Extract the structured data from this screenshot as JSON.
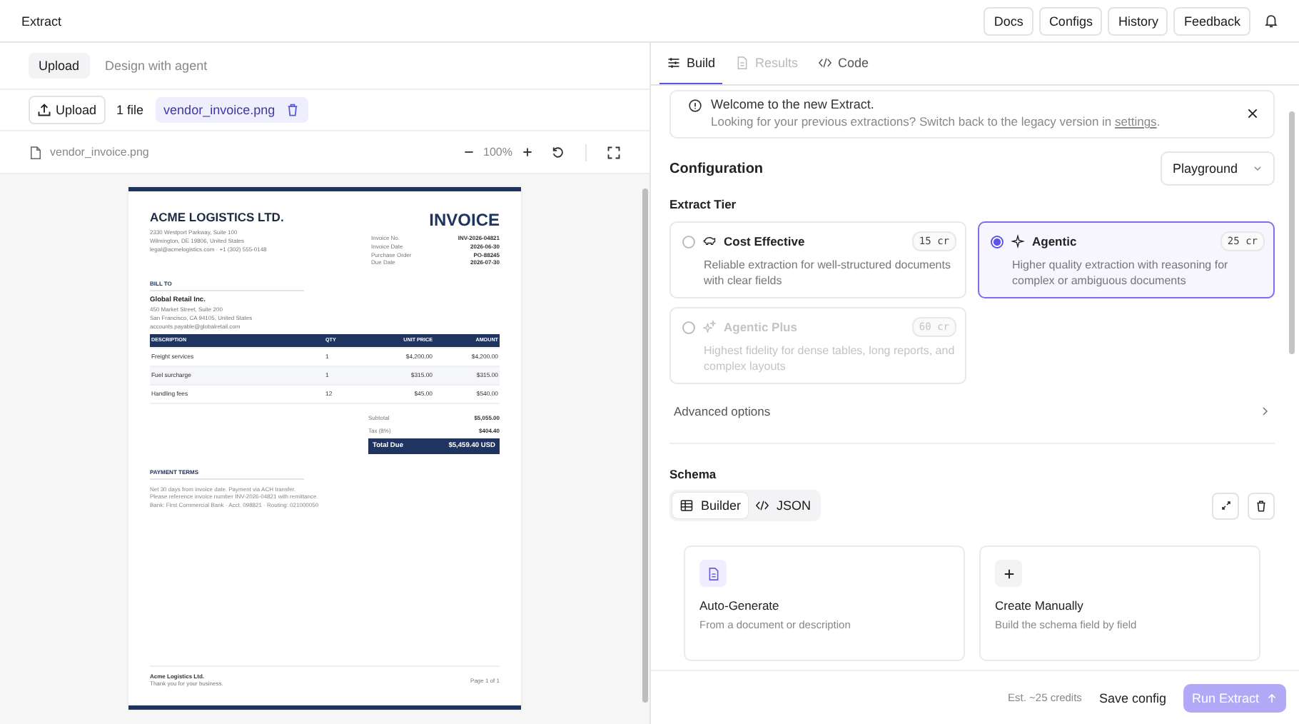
{
  "app_bar": {
    "title": "Extract",
    "buttons": [
      "Docs",
      "Configs",
      "History",
      "Feedback"
    ]
  },
  "left": {
    "tabs": [
      {
        "label": "Upload",
        "selected": true
      },
      {
        "label": "Design with agent",
        "selected": false
      }
    ],
    "upload_button": "Upload",
    "file_count": "1 file",
    "file_chip": "vendor_invoice.png",
    "viewer": {
      "file_name": "vendor_invoice.png",
      "zoom": "100%"
    }
  },
  "invoice": {
    "company": "ACME LOGISTICS LTD.",
    "address": [
      "2330 Westport Parkway, Suite 100",
      "Wilmington, DE 19806, United States",
      "legal@acmelogistics.com · +1 (302) 555-0148"
    ],
    "title": "INVOICE",
    "meta": [
      {
        "label": "Invoice No.",
        "value": "INV-2026-04821"
      },
      {
        "label": "Invoice Date",
        "value": "2026-06-30"
      },
      {
        "label": "Purchase Order",
        "value": "PO-88245"
      },
      {
        "label": "Due Date",
        "value": "2026-07-30"
      }
    ],
    "bill_to": {
      "heading": "BILL TO",
      "name": "Global Retail Inc.",
      "lines": [
        "450 Market Street, Suite 200",
        "San Francisco, CA 94105, United States",
        "accounts.payable@globalretail.com"
      ]
    },
    "columns": [
      "DESCRIPTION",
      "QTY",
      "UNIT PRICE",
      "AMOUNT"
    ],
    "rows": [
      [
        "Freight services",
        "1",
        "$4,200.00",
        "$4,200.00"
      ],
      [
        "Fuel surcharge",
        "1",
        "$315.00",
        "$315.00"
      ],
      [
        "Handling fees",
        "12",
        "$45.00",
        "$540.00"
      ]
    ],
    "totals": [
      {
        "label": "Subtotal",
        "value": "$5,055.00"
      },
      {
        "label": "Tax (8%)",
        "value": "$404.40"
      }
    ],
    "total_due": {
      "label": "Total Due",
      "value": "$5,459.40 USD"
    },
    "terms": {
      "heading": "PAYMENT TERMS",
      "lines": [
        "Net 30 days from invoice date. Payment via ACH transfer.",
        "Please reference invoice number INV-2026-04821 with remittance.",
        "Bank: First Commercial Bank · Acct. 098821 · Routing: 021000050"
      ]
    },
    "footer": {
      "company": "Acme Logistics Ltd.",
      "note": "Thank you for your business.",
      "page": "Page 1 of 1"
    }
  },
  "right": {
    "tabs": [
      {
        "label": "Build",
        "selected": true,
        "disabled": false
      },
      {
        "label": "Results",
        "selected": false,
        "disabled": true
      },
      {
        "label": "Code",
        "selected": false,
        "disabled": false
      }
    ],
    "banner": {
      "title": "Welcome to the new Extract.",
      "text": "Looking for your previous extractions? Switch back to the legacy version in",
      "link": "settings",
      "end": "."
    },
    "configuration": {
      "title": "Configuration",
      "mode": "Playground"
    },
    "tier_label": "Extract Tier",
    "tiers": [
      {
        "kind": "cost",
        "name": "Cost Effective",
        "cost": "15 cr",
        "description": "Reliable extraction for well-structured documents with clear fields",
        "selected": false,
        "disabled": false
      },
      {
        "kind": "agentic",
        "name": "Agentic",
        "cost": "25 cr",
        "description": "Higher quality extraction with reasoning for complex or ambiguous documents",
        "selected": true,
        "disabled": false
      },
      {
        "kind": "plus",
        "name": "Agentic Plus",
        "cost": "60 cr",
        "description": "Highest fidelity for dense tables, long reports, and complex layouts",
        "selected": false,
        "disabled": true
      }
    ],
    "advanced": "Advanced options",
    "schema": {
      "title": "Schema",
      "modes": [
        {
          "kind": "table",
          "label": "Builder",
          "selected": true
        },
        {
          "kind": "code",
          "label": "JSON",
          "selected": false
        }
      ],
      "cards": [
        {
          "kind": "auto",
          "title": "Auto-Generate",
          "description": "From a document or description"
        },
        {
          "kind": "manual",
          "title": "Create Manually",
          "description": "Build the schema field by field"
        }
      ]
    },
    "footer": {
      "estimate": "Est. ~25 credits",
      "save": "Save config",
      "run": {
        "label": "Run Extract",
        "disabled": true
      }
    }
  }
}
